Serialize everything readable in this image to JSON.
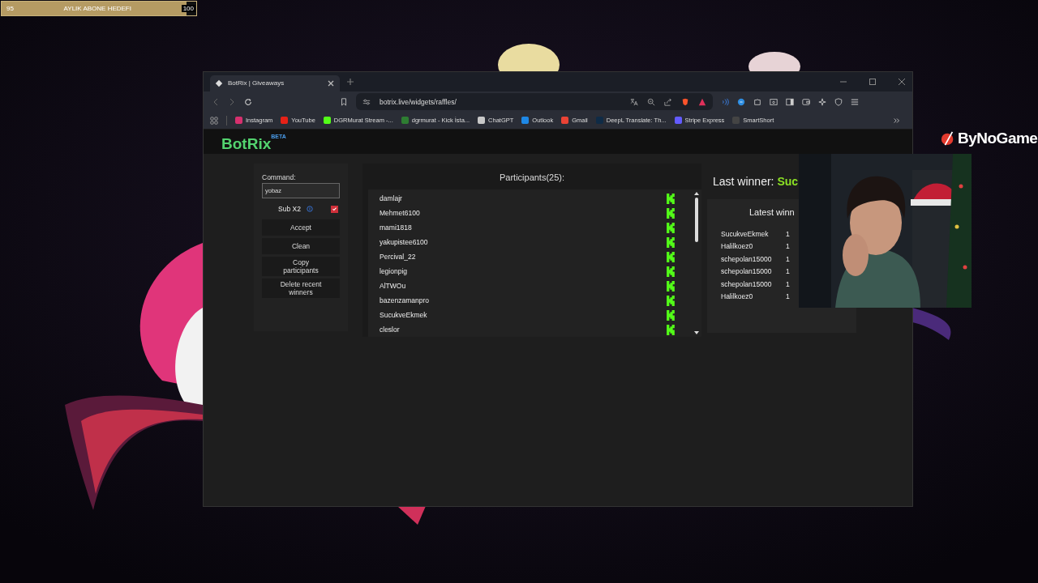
{
  "goal_bar": {
    "start": "95",
    "title": "AYLIK ABONE HEDEFI",
    "end": "100",
    "level": 0.95
  },
  "brand": {
    "name": "ByNoGame"
  },
  "browser": {
    "tab": {
      "title": "BotRix | Giveaways"
    },
    "address": "botrix.live/widgets/raffles/",
    "bookmarks": [
      {
        "label": "Instagram",
        "color": "#d6306e"
      },
      {
        "label": "YouTube",
        "color": "#e62117"
      },
      {
        "label": "DGRMurat Stream -...",
        "color": "#53fc18"
      },
      {
        "label": "dgrmurat - Kick İsta...",
        "color": "#2e7d32"
      },
      {
        "label": "ChatGPT",
        "color": "#c8c8c8"
      },
      {
        "label": "Outlook",
        "color": "#1e88e5"
      },
      {
        "label": "Gmail",
        "color": "#ea4335"
      },
      {
        "label": "DeepL Translate: Th...",
        "color": "#0f2b46"
      },
      {
        "label": "Stripe Express",
        "color": "#635bff"
      },
      {
        "label": "SmartShort",
        "color": "#444444"
      }
    ]
  },
  "page": {
    "logo": "BotRix",
    "logo_badge": "BETA",
    "command_label": "Command:",
    "command_value": "yobaz",
    "sub_x2": {
      "label": "Sub X2",
      "checked": true
    },
    "buttons": [
      "Accept",
      "Clean",
      "Copy participants",
      "Delete recent winners"
    ],
    "participants_title": "Participants(25):",
    "participants": [
      "damlajr",
      "Mehmet6100",
      "mami1818",
      "yakupistee6100",
      "Percival_22",
      "legionpig",
      "AlTWOu",
      "bazenzamanpro",
      "SucukveEkmek",
      "cleslor"
    ],
    "last_winner_label": "Last winner:",
    "last_winner_name": "Suc",
    "latest_title": "Latest winn",
    "latest_winners": [
      {
        "name": "SucukveEkmek",
        "column_2": "1"
      },
      {
        "name": "Halilkoez0",
        "column_2": "1"
      },
      {
        "name": "schepolan15000",
        "column_2": "1"
      },
      {
        "name": "schepolan15000",
        "column_2": "1"
      },
      {
        "name": "schepolan15000",
        "column_2": "1"
      },
      {
        "name": "Halilkoez0",
        "column_2": "1"
      }
    ]
  }
}
